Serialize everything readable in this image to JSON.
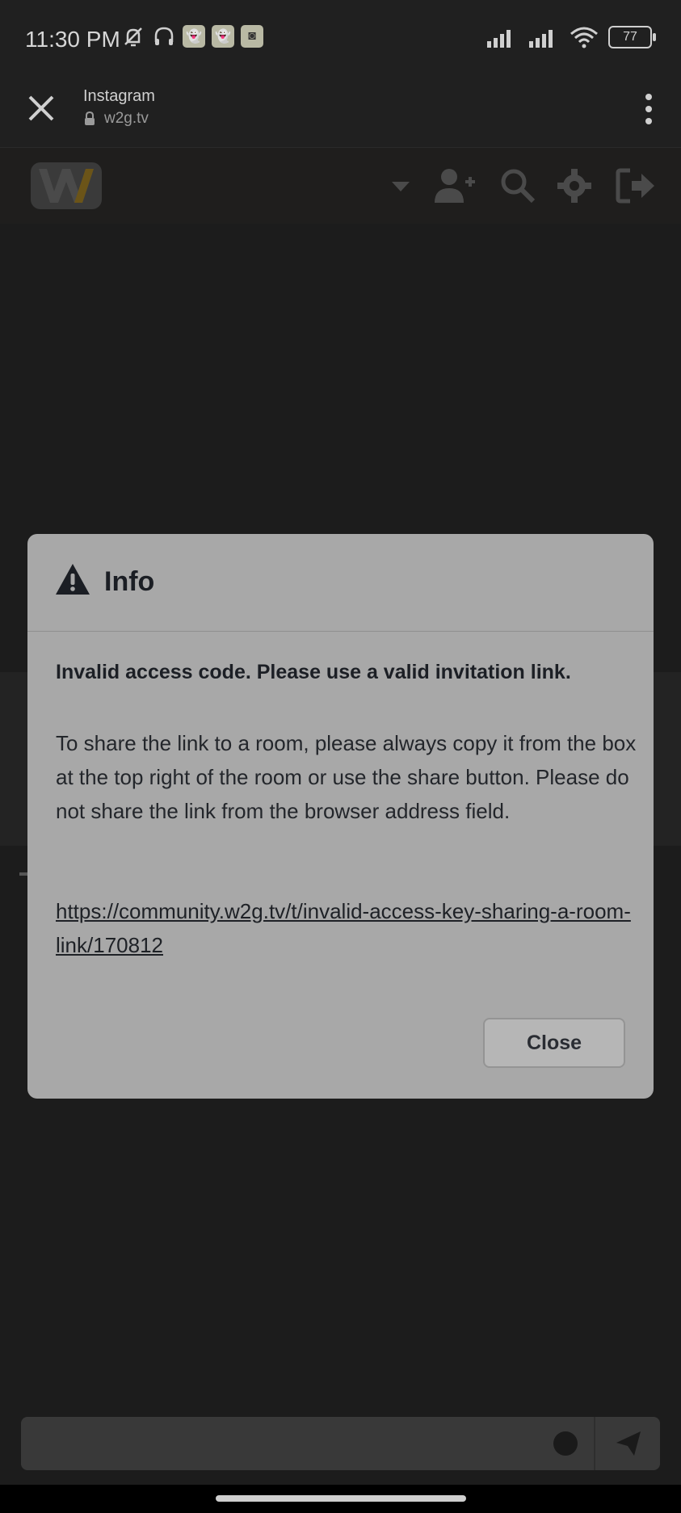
{
  "status_bar": {
    "time": "11:30 PM",
    "battery": "77"
  },
  "browser": {
    "title": "Instagram",
    "url": "w2g.tv"
  },
  "modal": {
    "title": "Info",
    "error_message": "Invalid access code. Please use a valid invitation link.",
    "body": "To share the link to a room, please always copy it from the box at the top right of the room or use the share button. Please do not share the link from the browser address field.",
    "link": "https://community.w2g.tv/t/invalid-access-key-sharing-a-room-link/170812",
    "close_label": "Close"
  },
  "colors": {
    "overlay_bg": "#1c1c1c",
    "modal_bg": "#a8a8a8",
    "logo_accent": "#8a6a1a"
  },
  "icons": {
    "browser_close": "close-icon",
    "secure": "lock-icon",
    "menu": "kebab-menu-icon",
    "dropdown": "caret-down-icon",
    "invite": "user-plus-icon",
    "search": "search-icon",
    "settings": "gear-icon",
    "exit": "sign-out-icon",
    "warning": "warning-triangle-icon",
    "emoji": "emoji-icon",
    "send": "send-icon"
  }
}
